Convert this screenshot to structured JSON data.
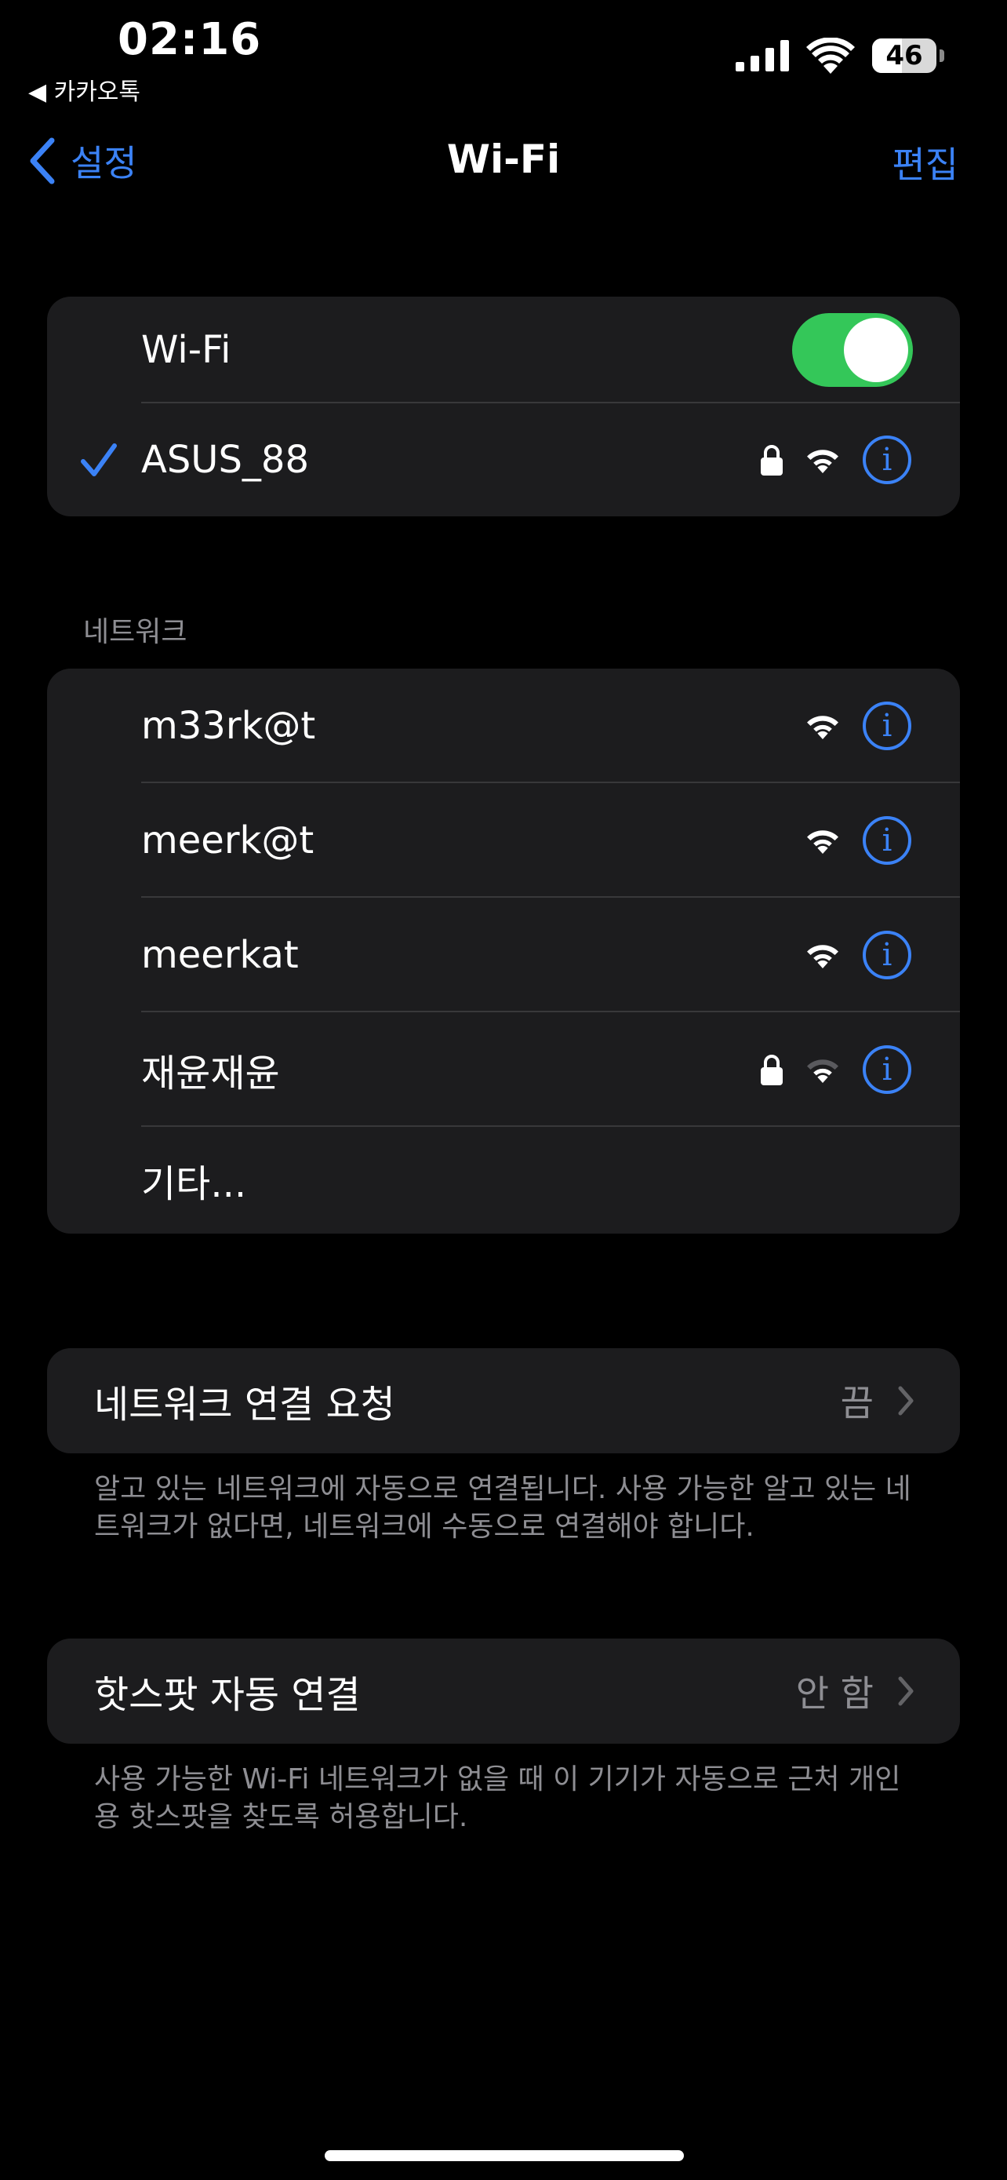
{
  "status_bar": {
    "time": "02:16",
    "back_app": "◀ 카카오톡",
    "battery": "46",
    "icons": [
      "cellular-signal-icon",
      "wifi-icon",
      "battery-icon"
    ]
  },
  "nav": {
    "back_label": "설정",
    "title": "Wi-Fi",
    "edit_label": "편집"
  },
  "wifi_group": {
    "toggle_label": "Wi-Fi",
    "toggle_on": true,
    "connected_network": "ASUS_88"
  },
  "networks": {
    "header": "네트워크",
    "items": [
      {
        "name": "m33rk@t",
        "locked": false
      },
      {
        "name": "meerk@t",
        "locked": false
      },
      {
        "name": "meerkat",
        "locked": false
      },
      {
        "name": "재윤재윤",
        "locked": true
      }
    ],
    "other_label": "기타..."
  },
  "ask_to_join": {
    "label": "네트워크 연결 요청",
    "value": "끔",
    "footnote": "알고 있는 네트워크에 자동으로 연결됩니다. 사용 가능한 알고 있는 네트워크가 없다면, 네트워크에 수동으로 연결해야 합니다."
  },
  "hotspot": {
    "label": "핫스팟 자동 연결",
    "value": "안 함",
    "footnote": "사용 가능한 Wi-Fi 네트워크가 없을 때 이 기기가 자동으로 근처 개인용 핫스팟을 찾도록 허용합니다."
  },
  "colors": {
    "accent": "#3b82f6",
    "toggle_on": "#34c759",
    "group_bg": "#1c1c1e",
    "secondary_text": "#8e8e93"
  }
}
